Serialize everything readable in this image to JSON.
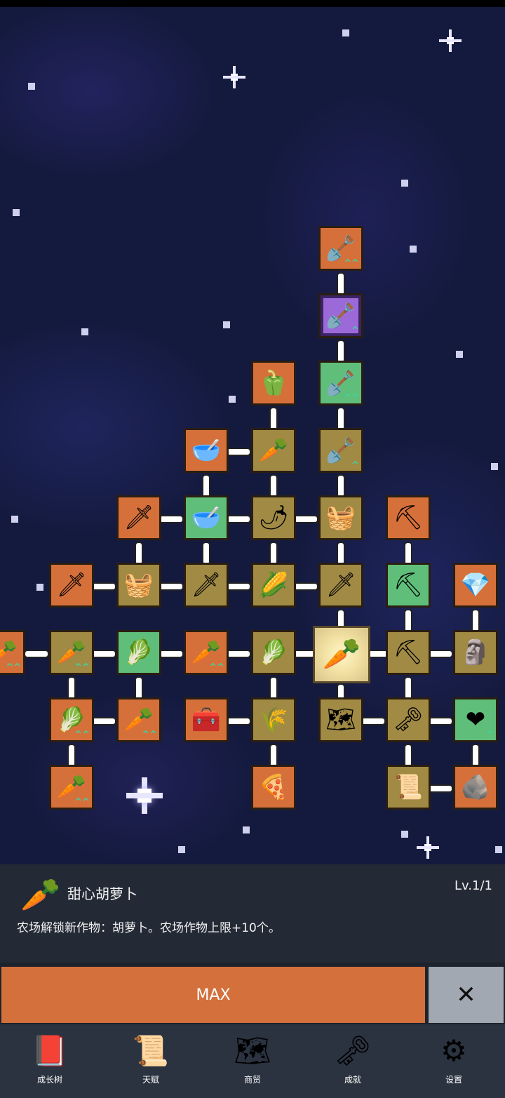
{
  "tree": {
    "nodes": [
      {
        "id": "n1",
        "icon": "🪏",
        "color": "orange",
        "up": "^^"
      },
      {
        "id": "n2",
        "icon": "🪏",
        "color": "purple",
        "up": "^"
      },
      {
        "id": "n3",
        "icon": "🫑",
        "color": "orange",
        "up": ""
      },
      {
        "id": "n4",
        "icon": "🪏",
        "color": "green",
        "up": "^^"
      },
      {
        "id": "n5",
        "icon": "🥣",
        "color": "orange",
        "up": ""
      },
      {
        "id": "n6",
        "icon": "🥕",
        "color": "olive",
        "up": ""
      },
      {
        "id": "n7",
        "icon": "🪏",
        "color": "olive",
        "up": "^"
      },
      {
        "id": "n8",
        "icon": "🗡",
        "color": "orange",
        "up": ""
      },
      {
        "id": "n9",
        "icon": "🥣",
        "color": "green",
        "up": ""
      },
      {
        "id": "n10",
        "icon": "🌶",
        "color": "olive",
        "up": ""
      },
      {
        "id": "n11",
        "icon": "🧺",
        "color": "olive",
        "up": ""
      },
      {
        "id": "n12",
        "icon": "⛏",
        "color": "orange",
        "up": ""
      },
      {
        "id": "n13",
        "icon": "🗡",
        "color": "orange",
        "up": ""
      },
      {
        "id": "n14",
        "icon": "🧺",
        "color": "olive",
        "up": ""
      },
      {
        "id": "n15",
        "icon": "🗡",
        "color": "olive",
        "up": ""
      },
      {
        "id": "n16",
        "icon": "🌽",
        "color": "olive",
        "up": ""
      },
      {
        "id": "n17",
        "icon": "🗡",
        "color": "olive",
        "up": ""
      },
      {
        "id": "n18",
        "icon": "⛏",
        "color": "green",
        "up": ""
      },
      {
        "id": "n19",
        "icon": "💎",
        "color": "orange",
        "up": ""
      },
      {
        "id": "n20",
        "icon": "🥕",
        "color": "orange",
        "up": "^^"
      },
      {
        "id": "n21",
        "icon": "🥕",
        "color": "olive",
        "up": "^^"
      },
      {
        "id": "n22",
        "icon": "🥬",
        "color": "green",
        "up": ""
      },
      {
        "id": "n23",
        "icon": "🥕",
        "color": "orange",
        "up": "^^"
      },
      {
        "id": "n24",
        "icon": "🥬",
        "color": "olive",
        "up": ""
      },
      {
        "id": "n25",
        "icon": "🥕",
        "color": "selected",
        "up": ""
      },
      {
        "id": "n26",
        "icon": "⛏",
        "color": "olive",
        "up": ""
      },
      {
        "id": "n27",
        "icon": "🗿",
        "color": "olive",
        "up": ""
      },
      {
        "id": "n28",
        "icon": "🥬",
        "color": "orange",
        "up": "^^"
      },
      {
        "id": "n29",
        "icon": "🥕",
        "color": "orange",
        "up": "^^"
      },
      {
        "id": "n30",
        "icon": "🧰",
        "color": "orange",
        "up": ""
      },
      {
        "id": "n31",
        "icon": "🌾",
        "color": "olive",
        "up": ""
      },
      {
        "id": "n32",
        "icon": "🗺",
        "color": "olive",
        "up": ""
      },
      {
        "id": "n33",
        "icon": "🗝",
        "color": "olive",
        "up": ""
      },
      {
        "id": "n34",
        "icon": "❤",
        "color": "green",
        "up": "^"
      },
      {
        "id": "n35",
        "icon": "🥕",
        "color": "orange",
        "up": "^^"
      },
      {
        "id": "n36",
        "icon": "🍕",
        "color": "orange",
        "up": ""
      },
      {
        "id": "n37",
        "icon": "📜",
        "color": "olive",
        "up": ""
      },
      {
        "id": "n38",
        "icon": "🪨",
        "color": "orange",
        "up": ""
      }
    ]
  },
  "detail": {
    "icon": "🥕",
    "title": "甜心胡萝卜",
    "level": "Lv.1/1",
    "description": "农场解锁新作物：胡萝卜。农场作物上限+10个。"
  },
  "actions": {
    "max_label": "MAX",
    "close_label": "✕"
  },
  "nav": {
    "items": [
      {
        "label": "成长树",
        "icon": "📕"
      },
      {
        "label": "天赋",
        "icon": "📜"
      },
      {
        "label": "商贸",
        "icon": "🗺"
      },
      {
        "label": "成就",
        "icon": "🗝"
      },
      {
        "label": "设置",
        "icon": "⚙"
      }
    ]
  },
  "colors": {
    "orange": "#d6703a",
    "green": "#5fbf7a",
    "olive": "#a08a44",
    "purple": "#9b6ad8",
    "max_button": "#d4703c",
    "close_button": "#a2a8b2"
  }
}
